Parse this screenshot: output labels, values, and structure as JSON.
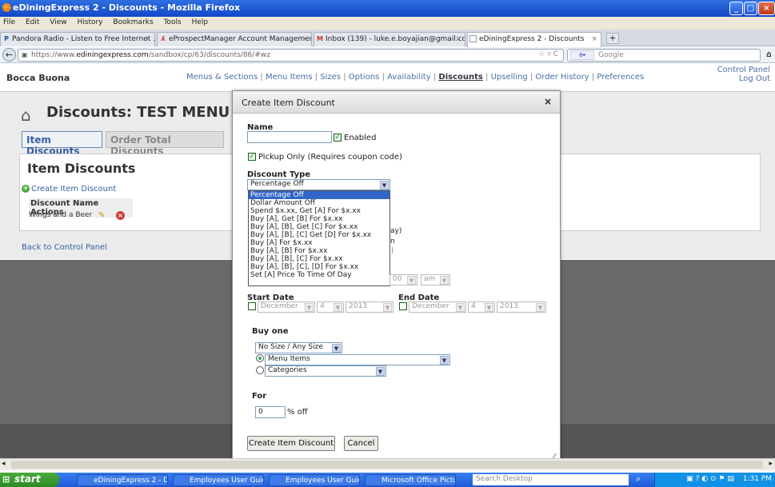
{
  "window": {
    "title": "eDiningExpress 2 - Discounts - Mozilla Firefox"
  },
  "menu": [
    "File",
    "Edit",
    "View",
    "History",
    "Bookmarks",
    "Tools",
    "Help"
  ],
  "tabs": [
    {
      "label": "Pandora Radio - Listen to Free Internet ...",
      "icon": "P"
    },
    {
      "label": "eProspectManager Account Management",
      "icon": "person-icon"
    },
    {
      "label": "Inbox (139) - luke.e.boyajian@gmail.com...",
      "icon": "M"
    },
    {
      "label": "eDiningExpress 2 - Discounts",
      "icon": ""
    }
  ],
  "tab_new": "+",
  "url": {
    "prefix": "https://www.",
    "domain": "ediningexpress.com",
    "path": "/sandbox/cp/63/discounts/86/#wz"
  },
  "search": {
    "placeholder": "Google"
  },
  "site": {
    "restaurant": "Bocca Buona",
    "nav": [
      "Menus & Sections",
      "Menu Items",
      "Sizes",
      "Options",
      "Availability",
      "Discounts",
      "Upselling",
      "Order History",
      "Preferences"
    ],
    "control_panel": "Control Panel",
    "logout": "Log Out"
  },
  "discounts": {
    "heading": "Discounts: TEST MENU",
    "tab_item": "Item Discounts",
    "tab_order": "Order Total Discounts",
    "sub_heading": "Item Discounts",
    "create_link": "Create Item Discount",
    "col_name": "Discount Name",
    "col_actions": "Actions",
    "row_name": "Wings and a Beer",
    "back": "Back to Control Panel"
  },
  "modal": {
    "title": "Create Item Discount",
    "close": "×",
    "name_label": "Name",
    "name_value": "",
    "enabled_label": "Enabled",
    "pickup_label": "Pickup Only (Requires coupon code)",
    "type_label": "Discount Type",
    "type_value": "Percentage Off",
    "type_options": [
      "Percentage Off",
      "Dollar Amount Off",
      "Spend $x.xx, Get [A] For $x.xx",
      "Buy [A], Get [B] For $x.xx",
      "Buy [A], [B], Get [C] For $x.xx",
      "Buy [A], [B], [C] Get [D] For $x.xx",
      "Buy [A] For $x.xx",
      "Buy [A], [B] For $x.xx",
      "Buy [A], [B], [C] For $x.xx",
      "Buy [A], [B], [C], [D] For $x.xx",
      "Set [A] Price To Time Of Day"
    ],
    "hidden_frag1": "ay)",
    "hidden_frag2": "n",
    "time_min": "00",
    "time_ampm": "am",
    "start_label": "Start Date",
    "end_label": "End Date",
    "start_month": "December",
    "start_day": "4",
    "start_year": "2013",
    "end_month": "December",
    "end_day": "4",
    "end_year": "2013",
    "buy_label": "Buy one",
    "size_value": "No Size / Any Size",
    "menu_items": "Menu Items",
    "categories": "Categories",
    "for_label": "For",
    "for_value": "0",
    "pct_label": "% off",
    "submit": "Create Item Discount",
    "cancel": "Cancel"
  },
  "taskbar": {
    "start": "start",
    "tasks": [
      "eDiningExpress 2 - Di...",
      "Employees User Guid...",
      "Employees User Guid...",
      "Microsoft Office Pictu..."
    ],
    "search_placeholder": "Search Desktop",
    "clock": "1:31 PM"
  }
}
